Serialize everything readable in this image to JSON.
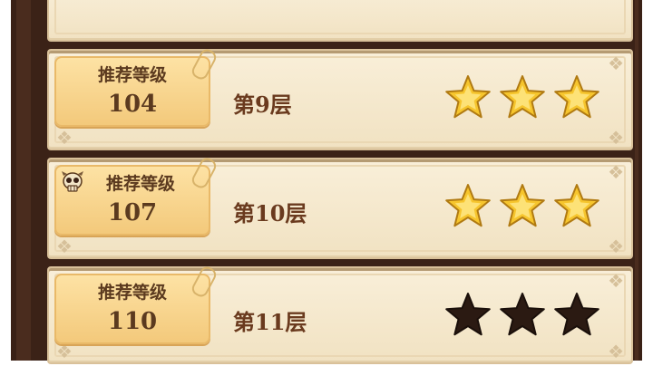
{
  "colors": {
    "star_filled": "#f6c52d",
    "star_empty": "#2b1a12",
    "frame": "#3b2217",
    "card": "#f4e6c8",
    "badge": "#f6cf83",
    "text": "#6a3a1e"
  },
  "levels": [
    {
      "badge_label": "推荐等级",
      "recommended_level": "104",
      "floor_label": "第9层",
      "stars_earned": 3,
      "stars_total": 3,
      "boss_icon": false
    },
    {
      "badge_label": "推荐等级",
      "recommended_level": "107",
      "floor_label": "第10层",
      "stars_earned": 3,
      "stars_total": 3,
      "boss_icon": true
    },
    {
      "badge_label": "推荐等级",
      "recommended_level": "110",
      "floor_label": "第11层",
      "stars_earned": 0,
      "stars_total": 3,
      "boss_icon": false
    }
  ]
}
